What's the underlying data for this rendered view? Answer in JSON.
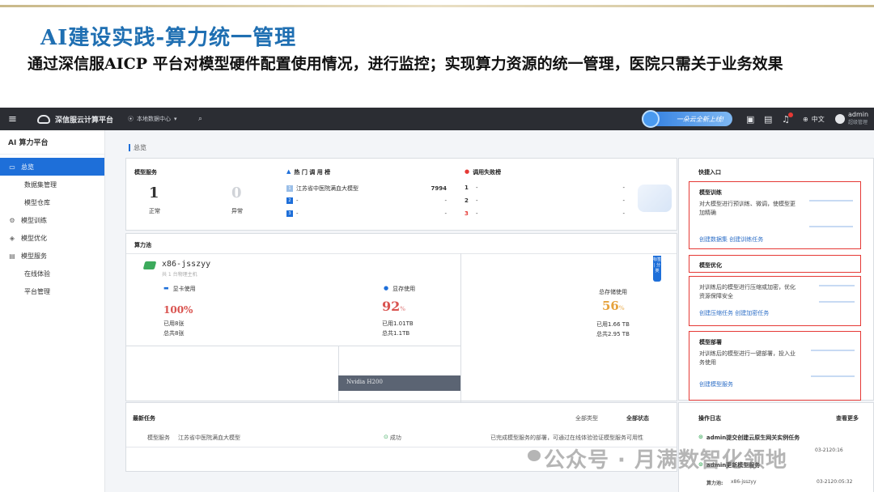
{
  "slide": {
    "title": "AI建设实践-算力统一管理",
    "desc": "通过深信服AICP 平台对模型硬件配置使用情况，进行监控；实现算力资源的统一管理，医院只需关于业务效果"
  },
  "appbar": {
    "product": "深信服云计算平台",
    "region": "本地数据中心",
    "banner": "一朵云全新上线!",
    "lang": "中文",
    "user": "admin",
    "user_role": "超级管理"
  },
  "sidebar": {
    "title": "AI 算力平台",
    "items": [
      {
        "label": "总览",
        "icon": "home-icon"
      },
      {
        "label": "数据集管理",
        "icon": ""
      },
      {
        "label": "模型仓库",
        "icon": ""
      },
      {
        "label": "模型训练",
        "icon": "gear-icon"
      },
      {
        "label": "模型优化",
        "icon": "cube-icon"
      },
      {
        "label": "模型服务",
        "icon": "monitor-icon"
      },
      {
        "label": "在线体验",
        "icon": ""
      },
      {
        "label": "平台管理",
        "icon": ""
      }
    ]
  },
  "breadcrumb": "总览",
  "model_service": {
    "label": "模型服务",
    "normal_value": "1",
    "normal_label": "正常",
    "abnormal_value": "0",
    "abnormal_label": "异常"
  },
  "hot_rank": {
    "label": "热 门 调 用 榜",
    "rows": [
      {
        "num": "1",
        "name": "江苏省中医院满血大模型",
        "value": "7994"
      },
      {
        "num": "2",
        "name": "-",
        "value": "-"
      },
      {
        "num": "3",
        "name": "-",
        "value": "-"
      }
    ]
  },
  "fail_rank": {
    "label": "调用失败榜",
    "rows": [
      {
        "num": "1",
        "name": "-",
        "value": "-"
      },
      {
        "num": "2",
        "name": "-",
        "value": "-"
      },
      {
        "num": "3",
        "name": "-",
        "value": "-"
      }
    ]
  },
  "compute": {
    "label": "算力池",
    "node_name": "x86-jsszyy",
    "node_sub": "共 1 台物理主机",
    "gpu_label": "显卡使用",
    "gpu_pct": "100%",
    "gpu_used": "已用8张",
    "gpu_total": "总共8张",
    "mem_label": "显存使用",
    "mem_pct": "92",
    "mem_unit": "%",
    "mem_used": "已用1.01TB",
    "mem_total": "总共1.1TB",
    "storage_label": "总存储使用",
    "storage_pct": "56",
    "storage_unit": "%",
    "storage_used": "已用1.66 TB",
    "storage_total": "总共2.95 TB",
    "gpu_model": "Nvidia H200",
    "side_tag": "标签 | 分类"
  },
  "tasks": {
    "label": "最新任务",
    "filter_type": "全部类型",
    "filter_status": "全部状态",
    "row_type": "模型服务",
    "row_name": "江苏省中医院满血大模型",
    "row_status": "成功",
    "row_desc": "已完成模型服务的部署，可通过在线体验验证模型服务可用性"
  },
  "quick": {
    "label": "快捷入口",
    "cards": [
      {
        "title": "模型训练",
        "desc": "对大模型进行预训练、微调，使模型更加精确",
        "links": "创建数据集  创建训练任务"
      },
      {
        "title": "模型优化",
        "desc": "对训练后的模型进行压缩或加密，优化资源保障安全",
        "links": "创建压缩任务  创建加密任务"
      },
      {
        "title": "模型部署",
        "desc": "对训练后的模型进行一键部署，投入业务使用",
        "links": "创建模型服务"
      }
    ]
  },
  "oplog": {
    "label": "操作日志",
    "more": "查看更多",
    "items": [
      {
        "text": "admin提交创建云原生网关实例任务",
        "time": "03-2120:16"
      },
      {
        "text": "admin更新模型服务",
        "time": ""
      }
    ],
    "footer_label": "算力池:",
    "footer_value": "x86-jsszyy",
    "footer_time": "03-2120:05:32"
  },
  "watermark": "公众号 · 月满数智化领地",
  "colors": {
    "accent": "#1e6fd9",
    "title": "#1f6fb2",
    "alert": "#e53935",
    "orange": "#e6a23c",
    "red_pct": "#d9534f"
  }
}
